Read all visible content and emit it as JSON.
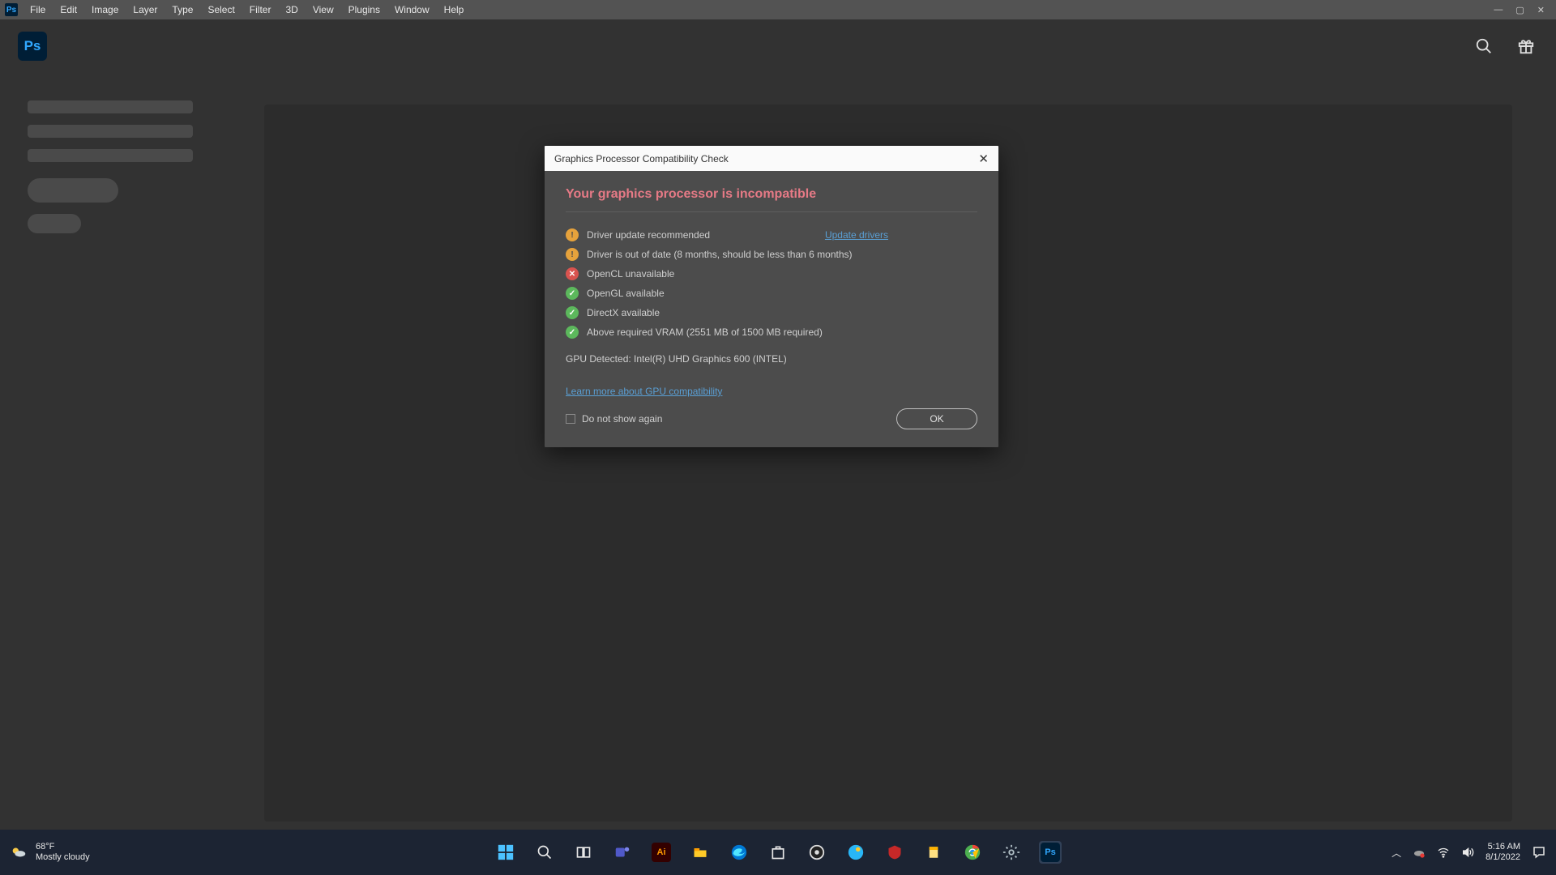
{
  "menu": {
    "items": [
      "File",
      "Edit",
      "Image",
      "Layer",
      "Type",
      "Select",
      "Filter",
      "3D",
      "View",
      "Plugins",
      "Window",
      "Help"
    ]
  },
  "dialog": {
    "title": "Graphics Processor Compatibility Check",
    "heading": "Your graphics processor is incompatible",
    "rows": [
      {
        "status": "warn",
        "text": "Driver update recommended",
        "link": "Update drivers"
      },
      {
        "status": "warn",
        "text": "Driver is out of date (8 months, should be less than 6 months)"
      },
      {
        "status": "err",
        "text": "OpenCL unavailable"
      },
      {
        "status": "ok",
        "text": "OpenGL available"
      },
      {
        "status": "ok",
        "text": "DirectX available"
      },
      {
        "status": "ok",
        "text": "Above required VRAM (2551 MB of 1500 MB required)"
      }
    ],
    "gpu_detected": "GPU Detected: Intel(R) UHD Graphics 600 (INTEL)",
    "learn_link": "Learn more about GPU compatibility",
    "dont_show": "Do not show again",
    "ok": "OK"
  },
  "weather": {
    "temp": "68°F",
    "desc": "Mostly cloudy"
  },
  "clock": {
    "time": "5:16 AM",
    "date": "8/1/2022"
  },
  "taskbar_apps": [
    "windows",
    "search",
    "taskview",
    "teams",
    "illustrator",
    "explorer",
    "edge",
    "store",
    "obs",
    "paint3d",
    "mcafee",
    "stickynotes",
    "chrome",
    "settings",
    "photoshop"
  ]
}
